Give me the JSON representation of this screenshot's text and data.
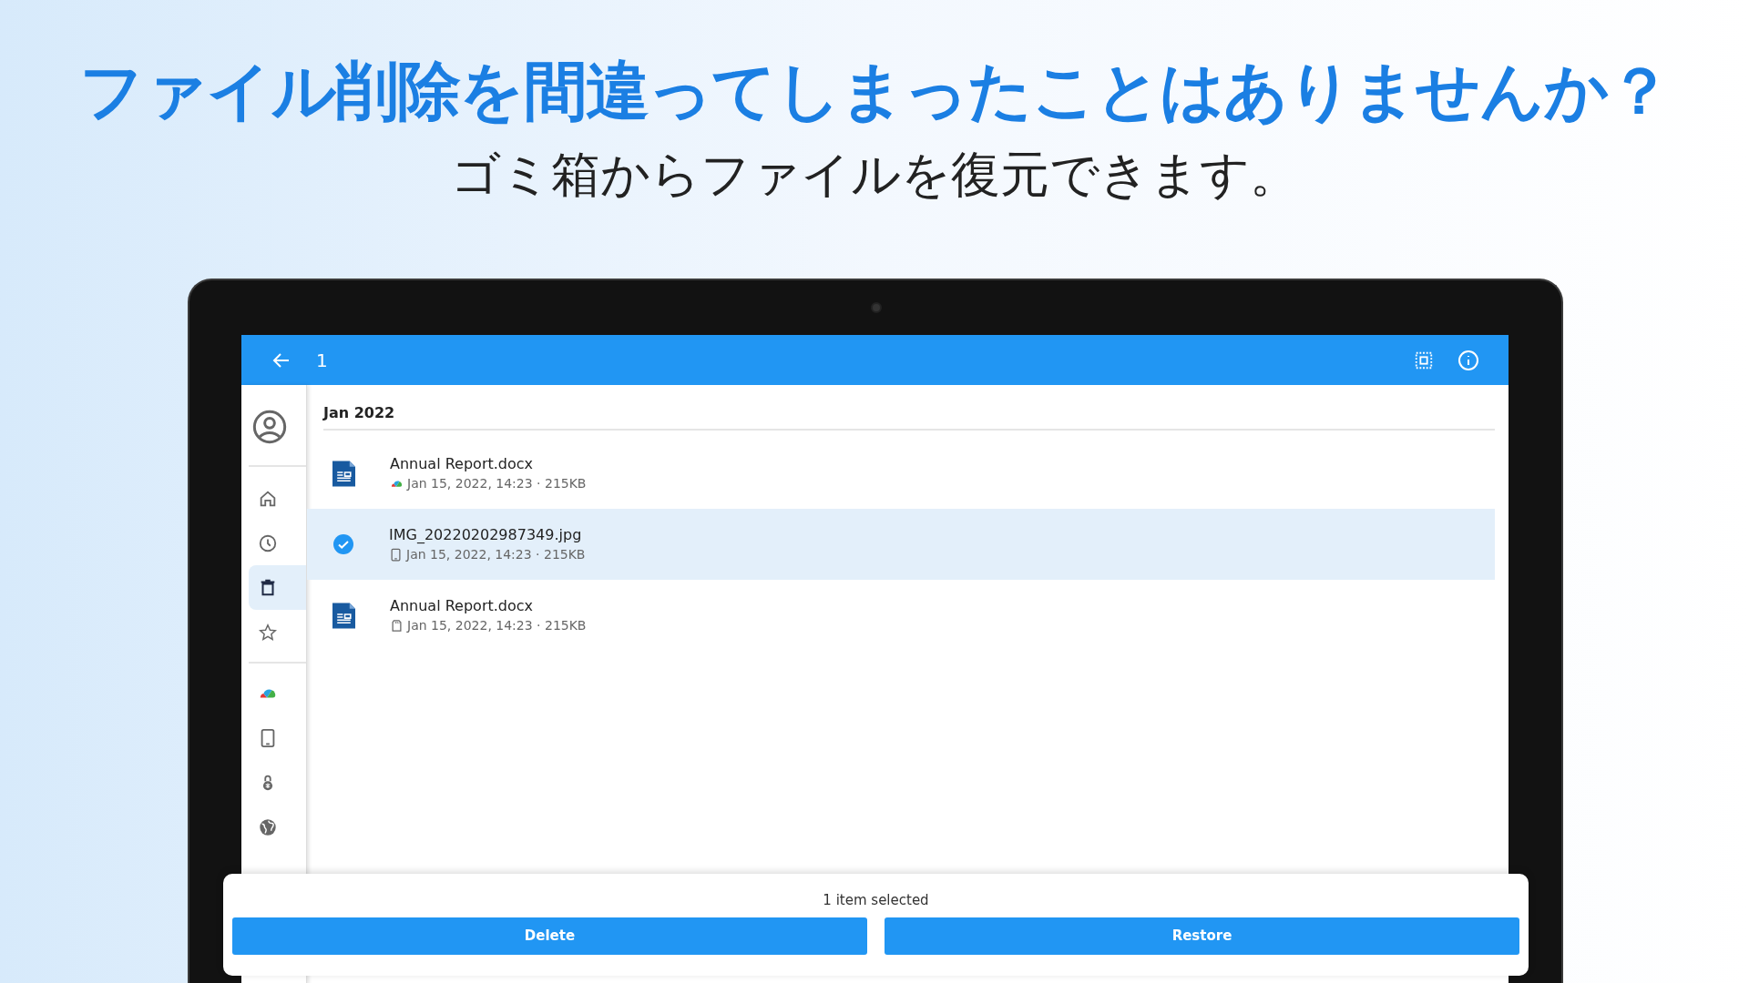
{
  "headline": "ファイル削除を間違ってしまったことはありませんか？",
  "subheadline": "ゴミ箱からファイルを復元できます。",
  "app_bar": {
    "title": "1"
  },
  "sidebar": {
    "items": [
      {
        "kind": "home",
        "selected": false
      },
      {
        "kind": "recent",
        "selected": false
      },
      {
        "kind": "trash",
        "selected": true
      },
      {
        "kind": "favorite",
        "selected": false
      },
      {
        "kind": "cloud",
        "selected": false
      },
      {
        "kind": "device",
        "selected": false
      },
      {
        "kind": "lock",
        "selected": false
      },
      {
        "kind": "network",
        "selected": false
      }
    ]
  },
  "list": {
    "group": "Jan 2022",
    "rows": [
      {
        "name": "Annual Report.docx",
        "meta": "Jan 15, 2022, 14:23 · 215KB",
        "kind": "cloud",
        "selected": false
      },
      {
        "name": "IMG_20220202987349.jpg",
        "meta": "Jan 15, 2022, 14:23 · 215KB",
        "kind": "device",
        "selected": true
      },
      {
        "name": "Annual Report.docx",
        "meta": "Jan 15, 2022, 14:23 · 215KB",
        "kind": "sdcard",
        "selected": false
      }
    ]
  },
  "bottom_sheet": {
    "status": "1 item selected",
    "buttons": [
      "Delete",
      "Restore"
    ]
  }
}
